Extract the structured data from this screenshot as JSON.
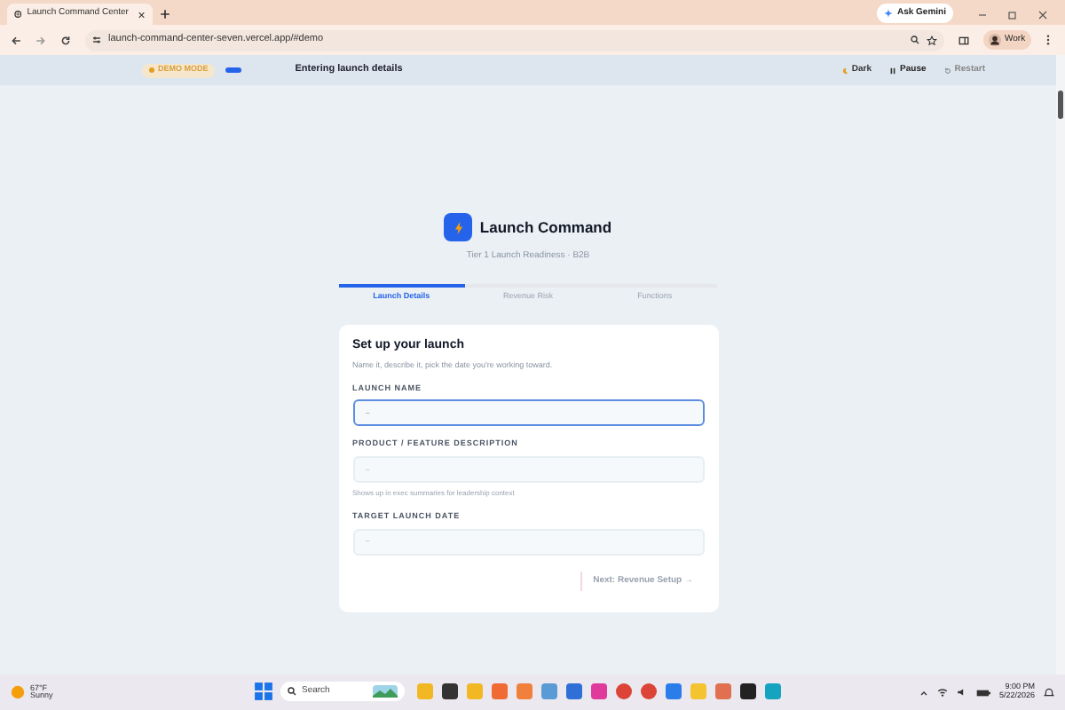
{
  "browser": {
    "tab_title": "Launch Command Center",
    "url": "launch-command-center-seven.vercel.app/#demo",
    "ask_gemini": "Ask Gemini",
    "profile": "Work"
  },
  "demo_bar": {
    "badge": "DEMO MODE",
    "status": "Entering launch details",
    "buttons": [
      {
        "kind": "dark",
        "label": "Dark"
      },
      {
        "kind": "pause",
        "label": "Pause"
      },
      {
        "kind": "restart",
        "label": "Restart"
      }
    ]
  },
  "header": {
    "title": "Launch Command",
    "subtitle": "Tier 1 Launch Readiness · B2B"
  },
  "steps": [
    {
      "label": "Launch Details",
      "selected": true
    },
    {
      "label": "Revenue Risk",
      "selected": false
    },
    {
      "label": "Functions",
      "selected": false
    }
  ],
  "card": {
    "title": "Set up your launch",
    "subtitle": "Name it, describe it, pick the date you're working toward.",
    "fields": [
      {
        "label": "LAUNCH NAME",
        "placeholder": "–",
        "focused": true
      },
      {
        "label": "PRODUCT / FEATURE DESCRIPTION",
        "placeholder": "–",
        "focused": false,
        "hint": "Shows up in exec summaries for leadership context"
      },
      {
        "label": "TARGET LAUNCH DATE",
        "placeholder": "–",
        "focused": false
      }
    ],
    "next_button": "Next: Revenue Setup →"
  },
  "taskbar": {
    "temperature": "67°F",
    "weather": "Sunny",
    "search_placeholder": "Search",
    "time": "9:00 PM",
    "date": "5/22/2026"
  }
}
